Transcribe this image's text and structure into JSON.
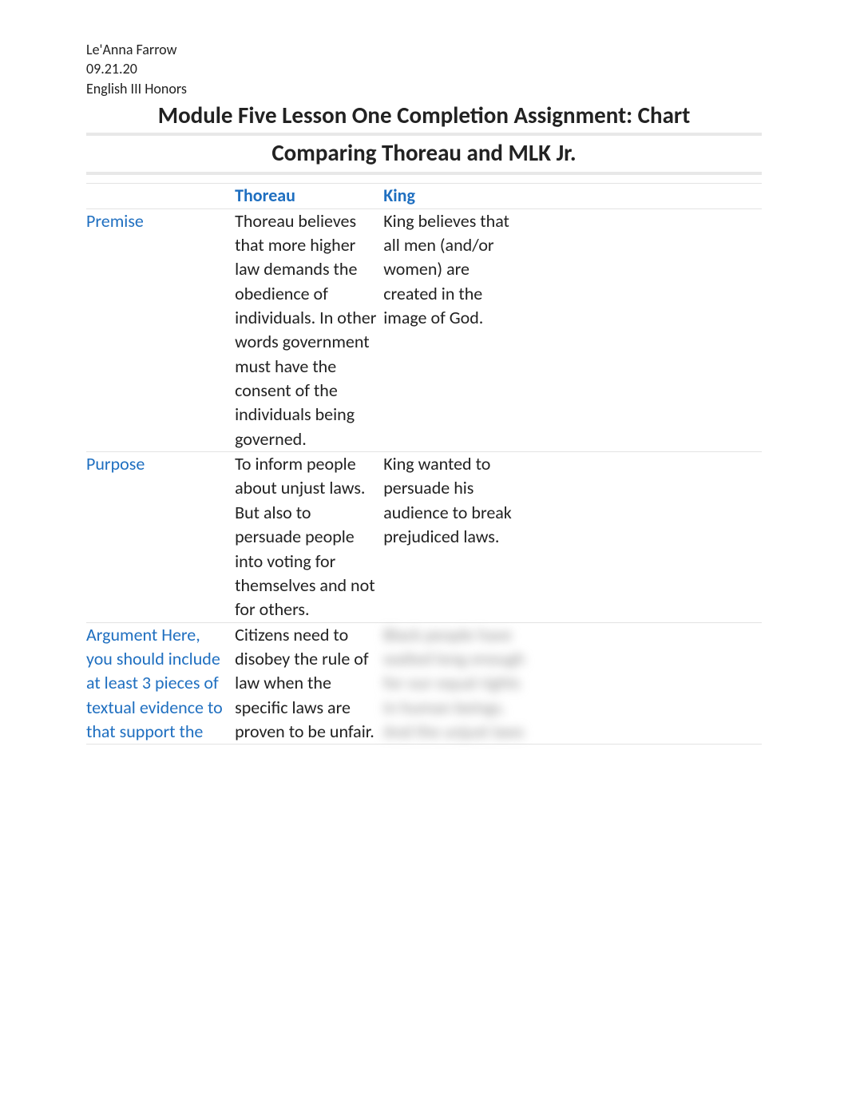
{
  "header": {
    "name": "Le'Anna Farrow",
    "date": "09.21.20",
    "course": "English III Honors"
  },
  "title": {
    "line1": "Module Five Lesson One Completion Assignment: Chart",
    "line2": "Comparing Thoreau and MLK Jr."
  },
  "table": {
    "columns": {
      "thoreau": "Thoreau",
      "king": "King"
    },
    "rows": [
      {
        "label": "Premise",
        "thoreau": "Thoreau believes that more higher law demands the obedience of individuals. In other words government must have the consent of the individuals being governed.",
        "king": "King believes that all men (and/or women) are created in the image of God."
      },
      {
        "label": "Purpose",
        "thoreau": "To inform people about unjust laws. But also to persuade people into voting for themselves and not for others.",
        "king": "King wanted to persuade his audience to break prejudiced laws."
      },
      {
        "label": "Argument Here, you should include at least 3 pieces of textual evidence to that support the",
        "thoreau": "Citizens need to disobey the rule of law when the specific laws are proven to be unfair.",
        "king": "Black people have waited long enough for our equal rights in human beings. And the unjust laws",
        "king_blurred": true
      }
    ]
  }
}
